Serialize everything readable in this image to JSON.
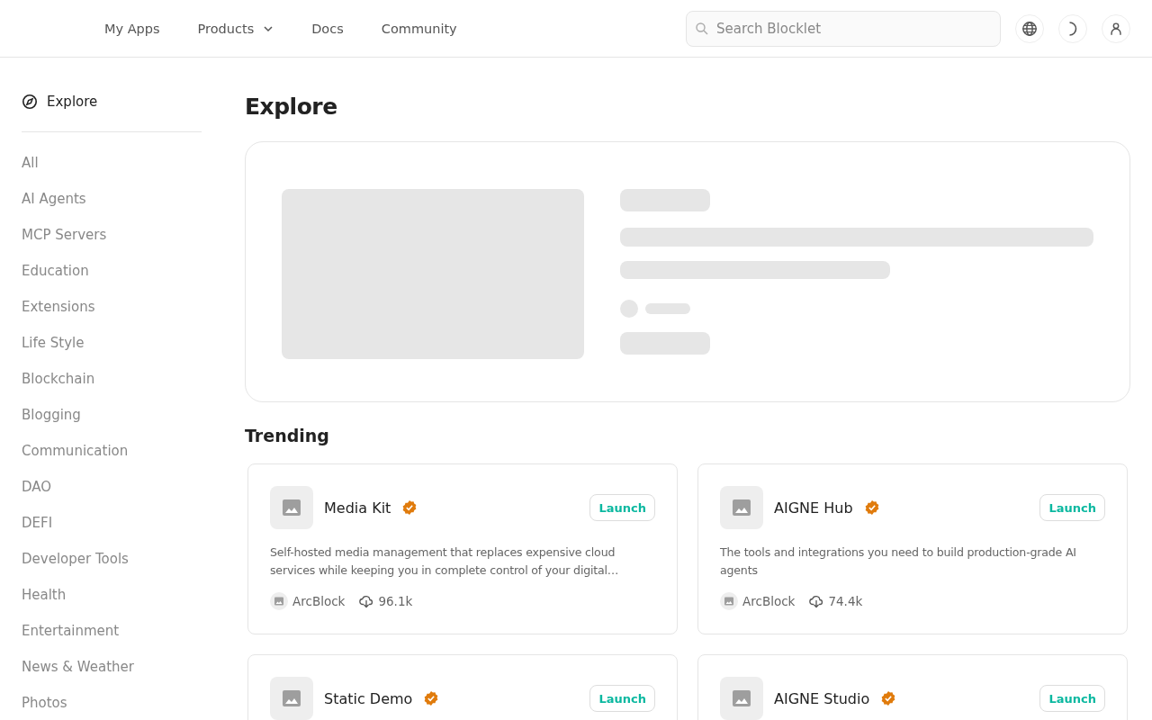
{
  "nav": {
    "links": [
      {
        "label": "My Apps",
        "kind": "link"
      },
      {
        "label": "Products",
        "kind": "dropdown"
      },
      {
        "label": "Docs",
        "kind": "link"
      },
      {
        "label": "Community",
        "kind": "link"
      }
    ],
    "search": {
      "placeholder": "Search Blocklet"
    }
  },
  "sidebar": {
    "heading": "Explore",
    "items": [
      {
        "label": "All"
      },
      {
        "label": "AI Agents"
      },
      {
        "label": "MCP Servers"
      },
      {
        "label": "Education"
      },
      {
        "label": "Extensions"
      },
      {
        "label": "Life Style"
      },
      {
        "label": "Blockchain"
      },
      {
        "label": "Blogging"
      },
      {
        "label": "Communication"
      },
      {
        "label": "DAO"
      },
      {
        "label": "DEFI"
      },
      {
        "label": "Developer Tools"
      },
      {
        "label": "Health"
      },
      {
        "label": "Entertainment"
      },
      {
        "label": "News & Weather"
      },
      {
        "label": "Photos"
      }
    ]
  },
  "title": "Explore",
  "trending": {
    "heading": "Trending",
    "cards": [
      {
        "name": "Media Kit",
        "verified": true,
        "button": "Launch",
        "description": "Self-hosted media management that replaces expensive cloud services while keeping you in complete control of your digital…",
        "author": "ArcBlock",
        "downloads": "96.1k"
      },
      {
        "name": "AIGNE Hub",
        "verified": true,
        "button": "Launch",
        "description": "The tools and integrations you need to build production-grade AI agents",
        "author": "ArcBlock",
        "downloads": "74.4k"
      },
      {
        "name": "Static Demo",
        "verified": true,
        "button": "Launch"
      },
      {
        "name": "AIGNE Studio",
        "verified": true,
        "button": "Launch"
      }
    ]
  }
}
